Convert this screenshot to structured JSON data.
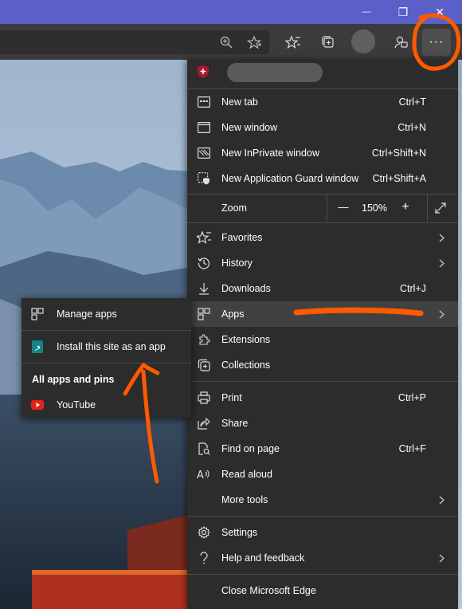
{
  "colors": {
    "titlebar": "#5b5fc8",
    "menu_bg": "#2c2c2c",
    "annotation": "#ff5a00",
    "youtube": "#e62117",
    "bing": "#138483"
  },
  "window": {
    "minimize_glyph": "—",
    "restore_glyph": "❐",
    "close_glyph": "✕"
  },
  "toolbar": {
    "more_glyph": "···"
  },
  "menu": {
    "items_top": [
      {
        "name": "new-tab",
        "label": "New tab",
        "shortcut": "Ctrl+T",
        "icon": "new-tab-icon"
      },
      {
        "name": "new-window",
        "label": "New window",
        "shortcut": "Ctrl+N",
        "icon": "window-icon"
      },
      {
        "name": "new-inprivate-window",
        "label": "New InPrivate window",
        "shortcut": "Ctrl+Shift+N",
        "icon": "inprivate-icon"
      },
      {
        "name": "new-application-guard-window",
        "label": "New Application Guard window",
        "shortcut": "Ctrl+Shift+A",
        "icon": "application-guard-icon"
      }
    ],
    "zoom": {
      "label": "Zoom",
      "value": "150%",
      "minus": "—",
      "plus": "+"
    },
    "items_mid": [
      {
        "name": "favorites",
        "label": "Favorites",
        "shortcut": "",
        "icon": "favorites-icon",
        "submenu": true
      },
      {
        "name": "history",
        "label": "History",
        "shortcut": "",
        "icon": "history-icon",
        "submenu": true
      },
      {
        "name": "downloads",
        "label": "Downloads",
        "shortcut": "Ctrl+J",
        "icon": "download-icon",
        "submenu": false
      },
      {
        "name": "apps",
        "label": "Apps",
        "shortcut": "",
        "icon": "apps-icon",
        "submenu": true
      },
      {
        "name": "extensions",
        "label": "Extensions",
        "shortcut": "",
        "icon": "extensions-icon",
        "submenu": false
      },
      {
        "name": "collections",
        "label": "Collections",
        "shortcut": "",
        "icon": "collections-icon",
        "submenu": false
      }
    ],
    "items_tools": [
      {
        "name": "print",
        "label": "Print",
        "shortcut": "Ctrl+P",
        "icon": "print-icon",
        "submenu": false
      },
      {
        "name": "share",
        "label": "Share",
        "shortcut": "",
        "icon": "share-icon",
        "submenu": false
      },
      {
        "name": "find-on-page",
        "label": "Find on page",
        "shortcut": "Ctrl+F",
        "icon": "find-icon",
        "submenu": false
      },
      {
        "name": "read-aloud",
        "label": "Read aloud",
        "shortcut": "",
        "icon": "read-aloud-icon",
        "submenu": false
      },
      {
        "name": "more-tools",
        "label": "More tools",
        "shortcut": "",
        "icon": "",
        "submenu": true
      }
    ],
    "items_settings": [
      {
        "name": "settings",
        "label": "Settings",
        "icon": "gear-icon",
        "submenu": false
      },
      {
        "name": "help-and-feedback",
        "label": "Help and feedback",
        "icon": "help-icon",
        "submenu": true
      }
    ],
    "close": {
      "label": "Close Microsoft Edge"
    }
  },
  "apps_submenu": {
    "manage": "Manage apps",
    "install": "Install this site as an app",
    "header": "All apps and pins",
    "youtube": "YouTube"
  }
}
